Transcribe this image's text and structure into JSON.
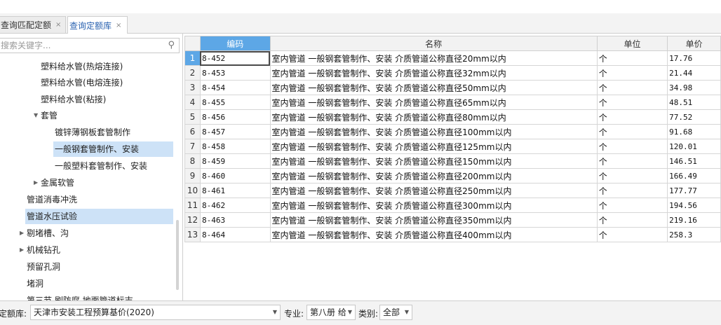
{
  "tabs": [
    {
      "label": "查询匹配定额",
      "close": "×"
    },
    {
      "label": "查询定额库",
      "close": "×"
    }
  ],
  "search": {
    "placeholder": "搜索关键字..."
  },
  "tree": {
    "nodes": [
      {
        "label": "塑料给水管(热熔连接)"
      },
      {
        "label": "塑料给水管(电熔连接)"
      },
      {
        "label": "塑料给水管(粘接)"
      },
      {
        "label": "套管"
      },
      {
        "label": "镀锌薄钢板套管制作"
      },
      {
        "label": "一般钢套管制作、安装"
      },
      {
        "label": "一般塑料套管制作、安装"
      },
      {
        "label": "金属软管"
      },
      {
        "label": "管道消毒冲洗"
      },
      {
        "label": "管道水压试验"
      },
      {
        "label": "剔堵槽、沟"
      },
      {
        "label": "机械钻孔"
      },
      {
        "label": "预留孔洞"
      },
      {
        "label": "堵洞"
      },
      {
        "label": "第三节 刷防腐 地面管道标志"
      }
    ]
  },
  "table": {
    "headers": [
      "编码",
      "名称",
      "单位",
      "单价"
    ],
    "rows": [
      {
        "n": "1",
        "code": "8-452",
        "name": "室内管道 一般钢套管制作、安装 介质管道公称直径20mm以内",
        "unit": "个",
        "price": "17.76"
      },
      {
        "n": "2",
        "code": "8-453",
        "name": "室内管道 一般钢套管制作、安装 介质管道公称直径32mm以内",
        "unit": "个",
        "price": "21.44"
      },
      {
        "n": "3",
        "code": "8-454",
        "name": "室内管道 一般钢套管制作、安装 介质管道公称直径50mm以内",
        "unit": "个",
        "price": "34.98"
      },
      {
        "n": "4",
        "code": "8-455",
        "name": "室内管道 一般钢套管制作、安装 介质管道公称直径65mm以内",
        "unit": "个",
        "price": "48.51"
      },
      {
        "n": "5",
        "code": "8-456",
        "name": "室内管道 一般钢套管制作、安装 介质管道公称直径80mm以内",
        "unit": "个",
        "price": "77.52"
      },
      {
        "n": "6",
        "code": "8-457",
        "name": "室内管道 一般钢套管制作、安装 介质管道公称直径100mm以内",
        "unit": "个",
        "price": "91.68"
      },
      {
        "n": "7",
        "code": "8-458",
        "name": "室内管道 一般钢套管制作、安装 介质管道公称直径125mm以内",
        "unit": "个",
        "price": "120.01"
      },
      {
        "n": "8",
        "code": "8-459",
        "name": "室内管道 一般钢套管制作、安装 介质管道公称直径150mm以内",
        "unit": "个",
        "price": "146.51"
      },
      {
        "n": "9",
        "code": "8-460",
        "name": "室内管道 一般钢套管制作、安装 介质管道公称直径200mm以内",
        "unit": "个",
        "price": "166.49"
      },
      {
        "n": "10",
        "code": "8-461",
        "name": "室内管道 一般钢套管制作、安装 介质管道公称直径250mm以内",
        "unit": "个",
        "price": "177.77"
      },
      {
        "n": "11",
        "code": "8-462",
        "name": "室内管道 一般钢套管制作、安装 介质管道公称直径300mm以内",
        "unit": "个",
        "price": "194.56"
      },
      {
        "n": "12",
        "code": "8-463",
        "name": "室内管道 一般钢套管制作、安装 介质管道公称直径350mm以内",
        "unit": "个",
        "price": "219.16"
      },
      {
        "n": "13",
        "code": "8-464",
        "name": "室内管道 一般钢套管制作、安装 介质管道公称直径400mm以内",
        "unit": "个",
        "price": "258.3"
      }
    ]
  },
  "bottom": {
    "library_label": "定额库:",
    "library_value": "天津市安装工程预算基价(2020)",
    "major_label": "专业:",
    "major_value": "第八册 给",
    "category_label": "类别:",
    "category_value": "全部"
  },
  "colors": {
    "accent": "#5da7e6",
    "selected_row": "#cde2f7",
    "active_tab_text": "#2a62b0"
  },
  "icons": {
    "search": "search-icon",
    "tree_expand": "triangle-down-icon",
    "tree_collapse": "triangle-right-icon",
    "dropdown": "chevron-down-icon"
  }
}
